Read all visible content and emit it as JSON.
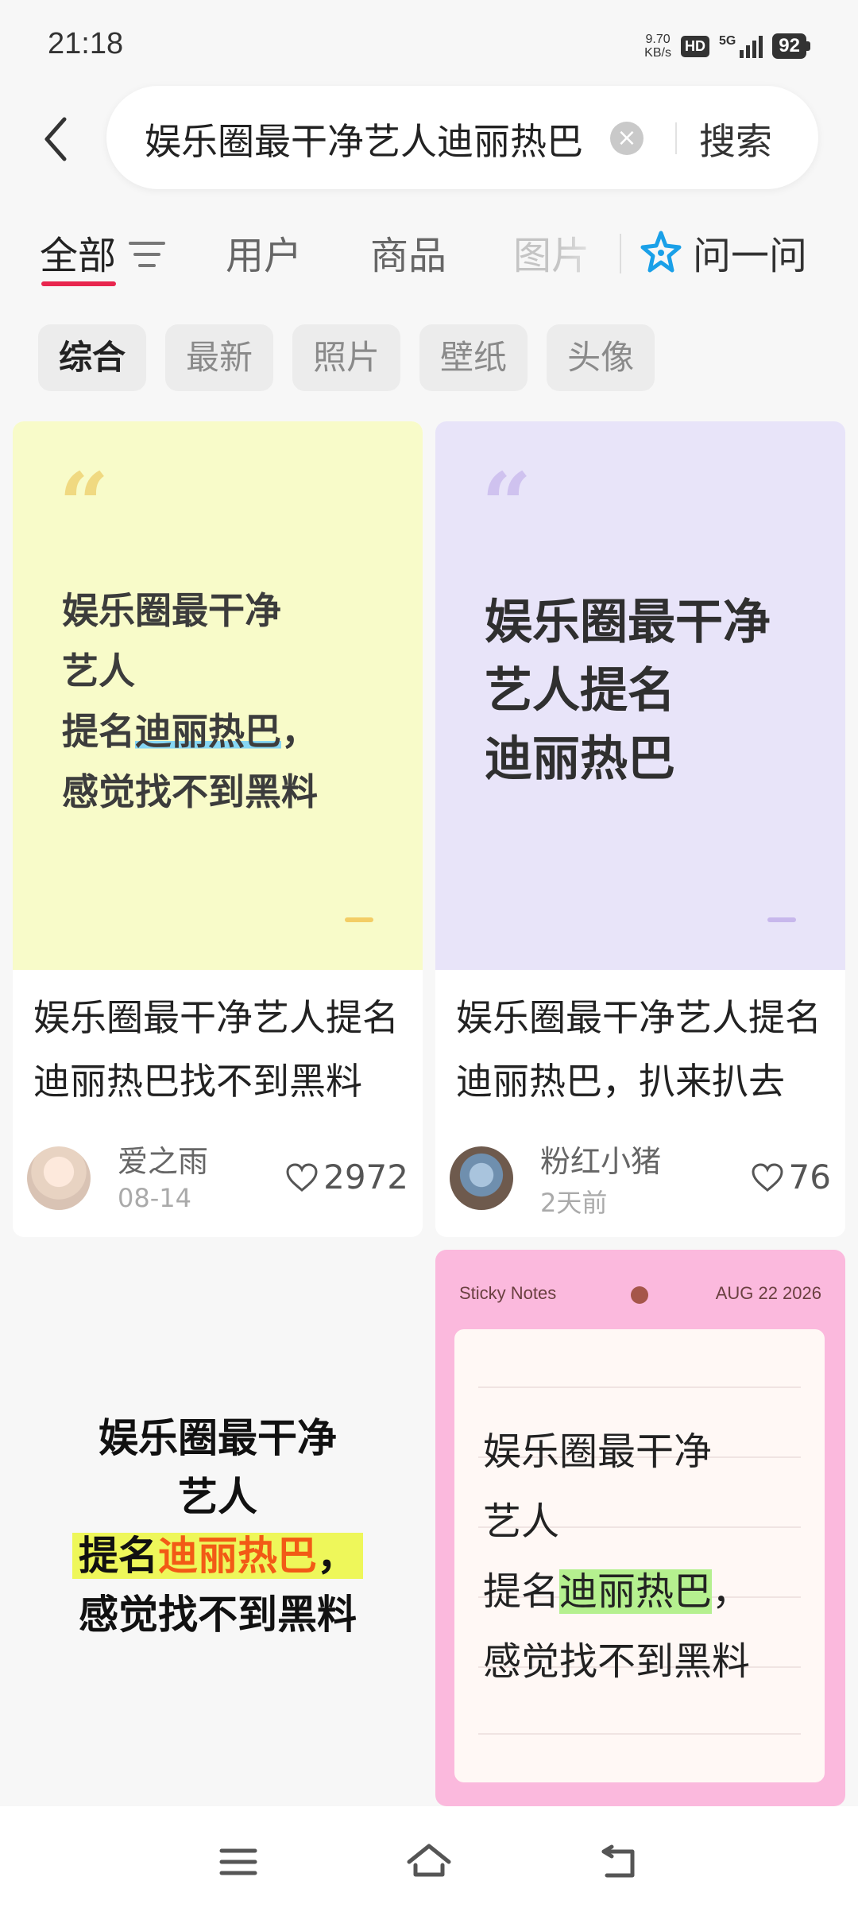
{
  "status_bar": {
    "time": "21:18",
    "net_speed_value": "9.70",
    "net_speed_unit": "KB/s",
    "hd_label": "HD",
    "network_label": "5G",
    "battery": "92"
  },
  "search": {
    "query": "娱乐圈最干净艺人迪丽热巴",
    "clear_icon": "clear-icon",
    "submit_label": "搜索"
  },
  "tabs": {
    "items": [
      {
        "label": "全部",
        "active": true
      },
      {
        "label": "用户"
      },
      {
        "label": "商品"
      },
      {
        "label": "图片"
      }
    ],
    "ask_label": "问一问",
    "accent_color": "#e8264e"
  },
  "filters": [
    "综合",
    "最新",
    "照片",
    "壁纸",
    "头像"
  ],
  "cards": [
    {
      "image_lines": [
        "娱乐圈最干净",
        "艺人",
        "提名",
        "迪丽热巴",
        "，",
        "感觉找不到黑料"
      ],
      "title": "娱乐圈最干净艺人提名迪丽热巴找不到黑料",
      "author": "爱之雨",
      "date": "08-14",
      "likes": "2972"
    },
    {
      "image_lines": [
        "娱乐圈最干净",
        "艺人提名",
        "迪丽热巴"
      ],
      "title": "娱乐圈最干净艺人提名迪丽热巴，扒来扒去",
      "author": "粉红小猪",
      "date": "2天前",
      "likes": "76"
    },
    {
      "image_lines": [
        "娱乐圈最干净",
        "艺人",
        "提名",
        "迪丽热巴",
        "，",
        "感觉找不到黑料"
      ]
    },
    {
      "header_label": "Sticky Notes",
      "header_date": "AUG 22 2026",
      "image_lines": [
        "娱乐圈最干净",
        "艺人",
        "提名",
        "迪丽热巴",
        "，",
        "感觉找不到黑料"
      ]
    }
  ],
  "nav": {
    "menu_icon": "menu-icon",
    "home_icon": "home-icon",
    "back_icon": "back-icon"
  }
}
